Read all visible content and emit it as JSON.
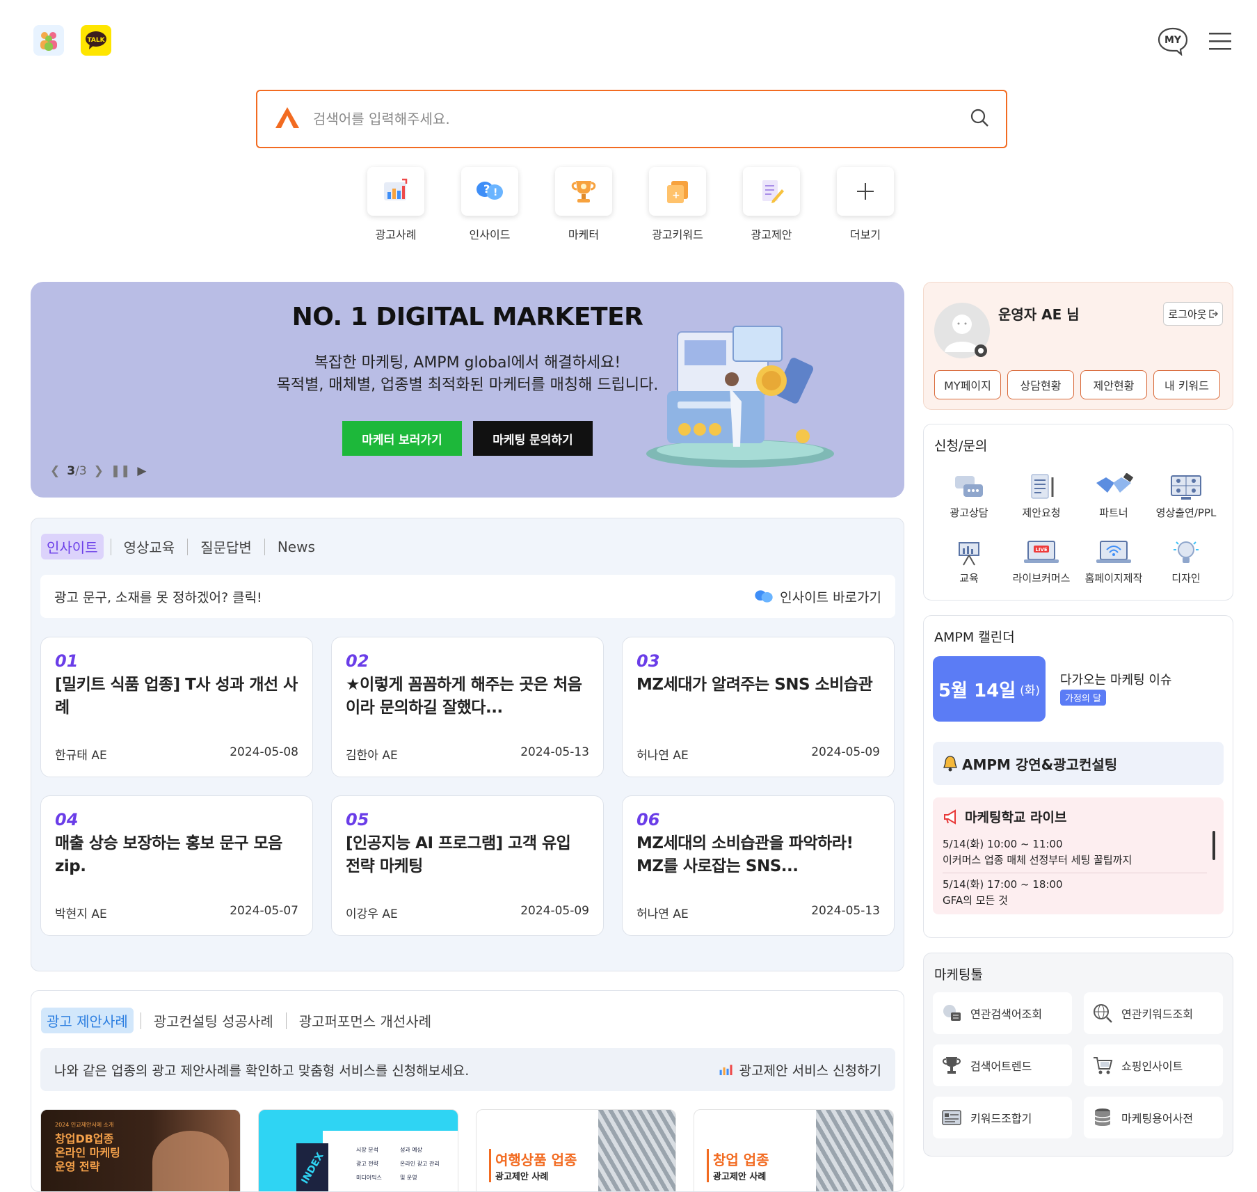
{
  "header": {
    "left_icons": [
      "people-icon",
      "kakaotalk-icon"
    ],
    "kakao_label": "TALK",
    "my_label": "MY"
  },
  "search": {
    "placeholder": "검색어를 입력해주세요."
  },
  "quick_menu": [
    {
      "label": "광고사례",
      "icon": "chart-icon"
    },
    {
      "label": "인사이드",
      "icon": "question-bubble-icon"
    },
    {
      "label": "마케터",
      "icon": "trophy-icon"
    },
    {
      "label": "광고키워드",
      "icon": "keyword-tag-icon"
    },
    {
      "label": "광고제안",
      "icon": "document-pen-icon"
    },
    {
      "label": "더보기",
      "icon": "plus-icon"
    }
  ],
  "banner": {
    "title": "NO. 1 DIGITAL MARKETER",
    "sub1": "복잡한 마케팅, AMPM global에서 해결하세요!",
    "sub2": "목적별, 매체별, 업종별 최적화된 마케터를 매칭해 드립니다.",
    "btn_marketer": "마케터 보러가기",
    "btn_inquiry": "마케팅 문의하기",
    "pager_current": "3",
    "pager_total": "/3"
  },
  "insight": {
    "tabs": [
      "인사이트",
      "영상교육",
      "질문답변",
      "News"
    ],
    "info_text": "광고 문구, 소재를 못 정하겠어? 클릭!",
    "info_link": "인사이트 바로가기",
    "cards": [
      {
        "num": "01",
        "title": "[밀키트 식품 업종] T사 성과 개선 사례",
        "author": "한규태 AE",
        "date": "2024-05-08"
      },
      {
        "num": "02",
        "title": "★이렇게 꼼꼼하게 해주는 곳은 처음이라 문의하길 잘했다...",
        "author": "김한아 AE",
        "date": "2024-05-13"
      },
      {
        "num": "03",
        "title": "MZ세대가 알려주는 SNS 소비습관",
        "author": "허나연 AE",
        "date": "2024-05-09"
      },
      {
        "num": "04",
        "title": "매출 상승 보장하는 홍보 문구 모음 zip.",
        "author": "박현지 AE",
        "date": "2024-05-07"
      },
      {
        "num": "05",
        "title": "[인공지능 AI 프로그램] 고객 유입 전략 마케팅",
        "author": "이강우 AE",
        "date": "2024-05-09"
      },
      {
        "num": "06",
        "title": "MZ세대의 소비습관을 파악하라! MZ를 사로잡는 SNS...",
        "author": "허나연 AE",
        "date": "2024-05-13"
      }
    ]
  },
  "proposal": {
    "tabs": [
      "광고 제안사례",
      "광고컨설팅 성공사례",
      "광고퍼포먼스 개선사례"
    ],
    "info_text": "나와 같은 업종의 광고 제안사례를 확인하고 맞춤형 서비스를 신청해보세요.",
    "info_link": "광고제안 서비스 신청하기",
    "thumbs": [
      {
        "small": "2024 인교제안서에 소개",
        "title1": "창업DB업종",
        "title2": "온라인 마케팅",
        "title3": "운영 전략"
      },
      {
        "stamp": "INDEX",
        "items": [
          "시장 분석",
          "광고 전략",
          "미디어믹스",
          "성과 예상",
          "온라인 광고 관리 및 운영"
        ]
      },
      {
        "title": "여행상품 업종",
        "sub": "광고제안 사례"
      },
      {
        "title": "창업 업종",
        "sub": "광고제안 사례"
      }
    ]
  },
  "profile": {
    "name": "운영자 AE 님",
    "logout": "로그아웃",
    "buttons": [
      "MY페이지",
      "상담현황",
      "제안현황",
      "내 키워드"
    ]
  },
  "apply": {
    "title": "신청/문의",
    "items": [
      {
        "label": "광고상담",
        "icon": "chat-bubbles-icon"
      },
      {
        "label": "제안요청",
        "icon": "document-list-icon"
      },
      {
        "label": "파트너",
        "icon": "handshake-icon"
      },
      {
        "label": "영상출연/PPL",
        "icon": "video-people-icon"
      },
      {
        "label": "교육",
        "icon": "presentation-board-icon"
      },
      {
        "label": "라이브커머스",
        "icon": "live-laptop-icon"
      },
      {
        "label": "홈페이지제작",
        "icon": "wifi-laptop-icon"
      },
      {
        "label": "디자인",
        "icon": "lightbulb-icon"
      }
    ]
  },
  "calendar": {
    "title": "AMPM 캘린더",
    "date": "5월 14일",
    "weekday": "(화)",
    "issue_title": "다가오는 마케팅 이슈",
    "issue_badge": "가정의 달",
    "lecture": "AMPM 강연&광고컨설팅",
    "live_title": "마케팅학교 라이브",
    "events": [
      {
        "time": "5/14(화) 10:00 ~ 11:00",
        "desc": "이커머스 업종 매체 선정부터 세팅 꿀팁까지"
      },
      {
        "time": "5/14(화) 17:00 ~ 18:00",
        "desc": "GFA의 모든 것"
      }
    ]
  },
  "tools": {
    "title": "마케팅툴",
    "items": [
      {
        "label": "연관검색어조회",
        "icon": "related-search-icon"
      },
      {
        "label": "연관키워드조회",
        "icon": "globe-search-icon"
      },
      {
        "label": "검색어트렌드",
        "icon": "trophy-icon"
      },
      {
        "label": "쇼핑인사이트",
        "icon": "cart-icon"
      },
      {
        "label": "키워드조합기",
        "icon": "keyword-card-icon"
      },
      {
        "label": "마케팅용어사전",
        "icon": "database-icon"
      }
    ]
  },
  "colors": {
    "accent_orange": "#f26b21",
    "insight_purple": "#6a3de8",
    "green_button": "#1db83a",
    "calendar_blue": "#5b7cf5"
  }
}
